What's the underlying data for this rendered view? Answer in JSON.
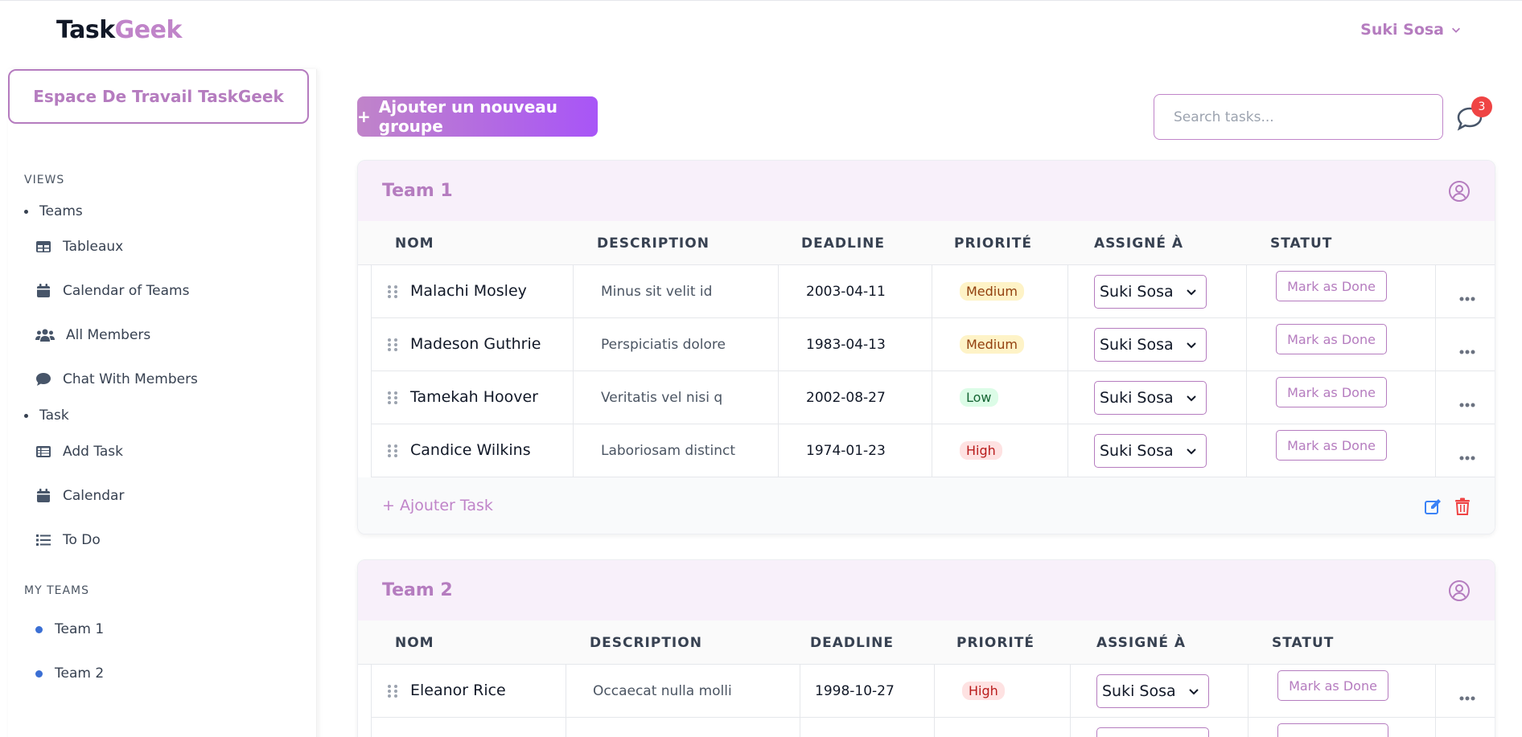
{
  "header": {
    "logo_part1": "Task",
    "logo_part2": "Geek",
    "user_name": "Suki Sosa"
  },
  "sidebar": {
    "workspace_label": "Espace De Travail TaskGeek",
    "views_title": "VIEWS",
    "teams_group": "Teams",
    "teams_items": [
      {
        "label": "Tableaux",
        "icon": "table-icon"
      },
      {
        "label": "Calendar of Teams",
        "icon": "calendar-icon"
      },
      {
        "label": "All Members",
        "icon": "users-icon"
      },
      {
        "label": "Chat With Members",
        "icon": "comment-icon"
      }
    ],
    "task_group": "Task",
    "task_items": [
      {
        "label": "Add Task",
        "icon": "list-table-icon"
      },
      {
        "label": "Calendar",
        "icon": "calendar-icon"
      },
      {
        "label": "To Do",
        "icon": "list-icon"
      }
    ],
    "my_teams_title": "MY TEAMS",
    "my_teams": [
      "Team 1",
      "Team 2"
    ]
  },
  "toolbar": {
    "add_group_plus": "+",
    "add_group_label": "Ajouter un nouveau groupe",
    "search_placeholder": "Search tasks...",
    "chat_badge": "3"
  },
  "columns": {
    "name": "NOM",
    "description": "DESCRIPTION",
    "deadline": "DEADLINE",
    "priority": "PRIORITÉ",
    "assigned": "ASSIGNÉ À",
    "status": "STATUT"
  },
  "groups": [
    {
      "title": "Team 1",
      "add_task_label": "+  Ajouter Task",
      "tasks": [
        {
          "name": "Malachi Mosley",
          "description": "Minus sit velit id",
          "deadline": "2003-04-11",
          "priority": "Medium",
          "assignee": "Suki Sosa",
          "status_btn": "Mark as Done"
        },
        {
          "name": "Madeson Guthrie",
          "description": "Perspiciatis dolore",
          "deadline": "1983-04-13",
          "priority": "Medium",
          "assignee": "Suki Sosa",
          "status_btn": "Mark as Done"
        },
        {
          "name": "Tamekah Hoover",
          "description": "Veritatis vel nisi q",
          "deadline": "2002-08-27",
          "priority": "Low",
          "assignee": "Suki Sosa",
          "status_btn": "Mark as Done"
        },
        {
          "name": "Candice Wilkins",
          "description": "Laboriosam distinct",
          "deadline": "1974-01-23",
          "priority": "High",
          "assignee": "Suki Sosa",
          "status_btn": "Mark as Done"
        }
      ]
    },
    {
      "title": "Team 2",
      "tasks": [
        {
          "name": "Eleanor Rice",
          "description": "Occaecat nulla molli",
          "deadline": "1998-10-27",
          "priority": "High",
          "assignee": "Suki Sosa",
          "status_btn": "Mark as Done"
        }
      ]
    }
  ],
  "colors": {
    "accent": "#b57cbf",
    "badge": "#ef4444",
    "team_dot": "#3b6fd4"
  }
}
